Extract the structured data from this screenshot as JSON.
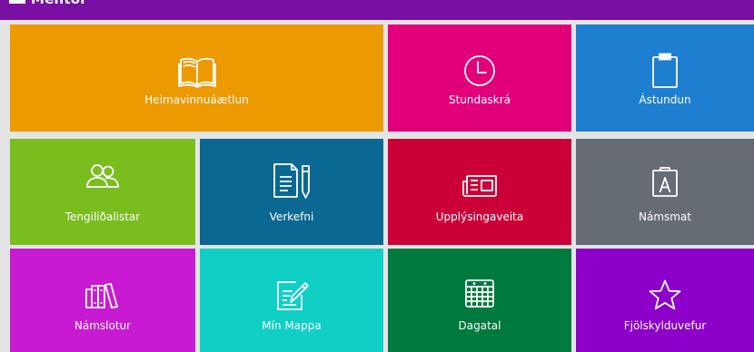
{
  "header": {
    "brand": "Mentor",
    "color": "#7a0fa3"
  },
  "tiles": [
    {
      "label": "Heimavinnuáætlun",
      "icon": "open-book-icon",
      "color": "#ec9a00"
    },
    {
      "label": "Stundaskrá",
      "icon": "clock-icon",
      "color": "#e1007a"
    },
    {
      "label": "Ástundun",
      "icon": "clipboard-icon",
      "color": "#1e7ecf"
    },
    {
      "label": "Tengiliðalistar",
      "icon": "contacts-people-icon",
      "color": "#79bd1f"
    },
    {
      "label": "Verkefni",
      "icon": "document-pencil-icon",
      "color": "#0b6892"
    },
    {
      "label": "Upplýsingaveita",
      "icon": "newspaper-icon",
      "color": "#cb0039"
    },
    {
      "label": "Námsmat",
      "icon": "grade-clipboard-icon",
      "color": "#666c74"
    },
    {
      "label": "Námslotur",
      "icon": "books-shelf-icon",
      "color": "#c91ad3"
    },
    {
      "label": "Mín Mappa",
      "icon": "edit-note-icon",
      "color": "#10cfc5"
    },
    {
      "label": "Dagatal",
      "icon": "calendar-icon",
      "color": "#007a3e"
    },
    {
      "label": "Fjölskylduvefur",
      "icon": "star-icon",
      "color": "#8c00c9"
    }
  ]
}
